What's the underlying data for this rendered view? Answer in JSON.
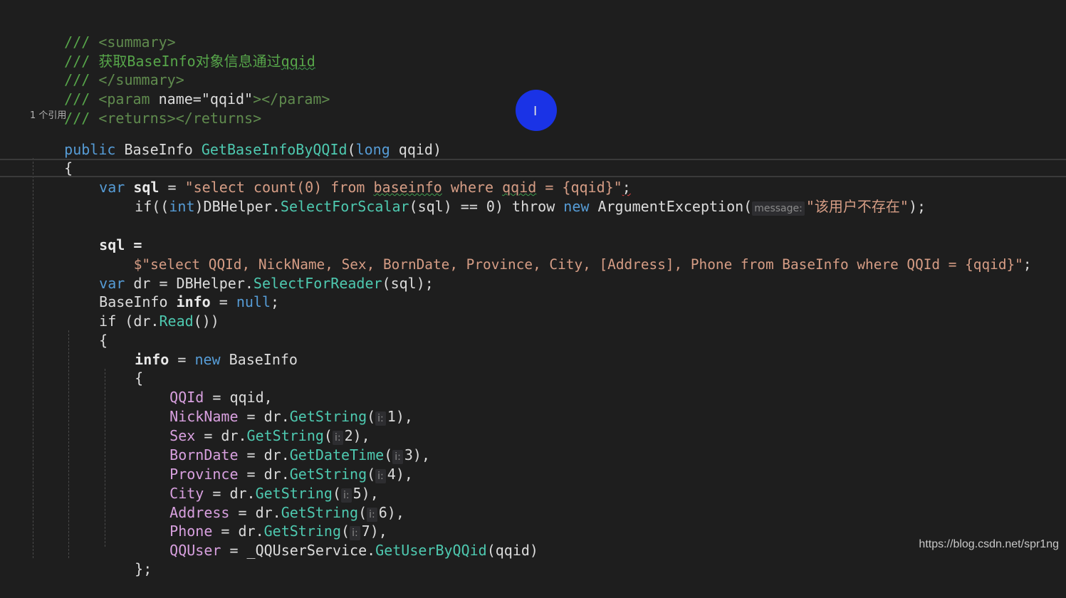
{
  "editor": {
    "codelens": "1 个引用",
    "doc": {
      "l1_slash": "///",
      "l1_tag": " <summary>",
      "l2_slash": "///",
      "l2_text": " 获取BaseInfo对象信息通过",
      "l2_param": "qqid",
      "l3_slash": "///",
      "l3_tag": " </summary>",
      "l4_slash": "///",
      "l4_tag_open": " <param ",
      "l4_attr": "name=\"qqid\"",
      "l4_tag_close": "></param>",
      "l5_slash": "///",
      "l5_tag": " <returns></returns>"
    },
    "sig": {
      "kw_public": "public",
      "ret_type": " BaseInfo ",
      "method": "GetBaseInfoByQQId",
      "open": "(",
      "kw_long": "long",
      "param": " qqid",
      "close": ")"
    },
    "brace_open": "{",
    "line_sql1": {
      "kw_var": "var",
      "name": " sql",
      "eq": " = ",
      "str_a": "\"select count(0) from ",
      "str_b": "baseinfo",
      "str_c": " where ",
      "str_d": "qqid",
      "str_e": " = {qqid}\"",
      "semi": ";"
    },
    "line_if1": {
      "if": "if",
      "p1": "((",
      "kw_int": "int",
      "p2": ")DBHelper.",
      "method": "SelectForScalar",
      "p3": "(sql) == 0) ",
      "throw": "throw",
      "sp": " ",
      "kw_new": "new",
      "exc": " ArgumentException(",
      "hint": "message:",
      "str": "\"该用户不存在\"",
      "end": ");"
    },
    "line_sql2a": "sql =",
    "line_sql2b": {
      "dollar": "$",
      "str": "\"select QQId, NickName, Sex, BornDate, Province, City, [Address], Phone from BaseInfo where QQId = {qqid}\"",
      "semi": ";"
    },
    "line_dr": {
      "kw_var": "var",
      "rest": " dr = DBHelper.",
      "method": "SelectForReader",
      "end": "(sql);"
    },
    "line_info": {
      "type": "BaseInfo ",
      "name": "info",
      "eq": " = ",
      "kw_null": "null",
      "semi": ";"
    },
    "line_if2": {
      "if": "if",
      "a": " (dr.",
      "method": "Read",
      "b": "())"
    },
    "brace2_open": "{",
    "line_new": {
      "name": "info",
      "eq": " = ",
      "kw_new": "new",
      "type": " BaseInfo"
    },
    "brace3_open": "{",
    "props": [
      {
        "name": "QQId",
        "eq": " = qqid,"
      },
      {
        "name": "NickName",
        "pre": " = dr.",
        "method": "GetString",
        "hint": "i:",
        "arg": "1),"
      },
      {
        "name": "Sex",
        "pre": " = dr.",
        "method": "GetString",
        "hint": "i:",
        "arg": "2),"
      },
      {
        "name": "BornDate",
        "pre": " = dr.",
        "method": "GetDateTime",
        "hint": "i:",
        "arg": "3),"
      },
      {
        "name": "Province",
        "pre": " = dr.",
        "method": "GetString",
        "hint": "i:",
        "arg": "4),"
      },
      {
        "name": "City",
        "pre": " = dr.",
        "method": "GetString",
        "hint": "i:",
        "arg": "5),"
      },
      {
        "name": "Address",
        "pre": " = dr.",
        "method": "GetString",
        "hint": "i:",
        "arg": "6),"
      },
      {
        "name": "Phone",
        "pre": " = dr.",
        "method": "GetString",
        "hint": "i:",
        "arg": "7),"
      }
    ],
    "line_qquser": {
      "name": "QQUser",
      "pre": " = _QQUserService.",
      "method": "GetUserByQQid",
      "end": "(qqid)"
    },
    "brace3_close": "};"
  },
  "watermark": "https://blog.csdn.net/spr1ng",
  "colors": {
    "background": "#1e1e1e",
    "comment": "#57a64a",
    "keyword": "#569cd6",
    "method": "#4ec9b0",
    "string": "#d69d85",
    "cursor_highlight": "#1a33e6"
  }
}
